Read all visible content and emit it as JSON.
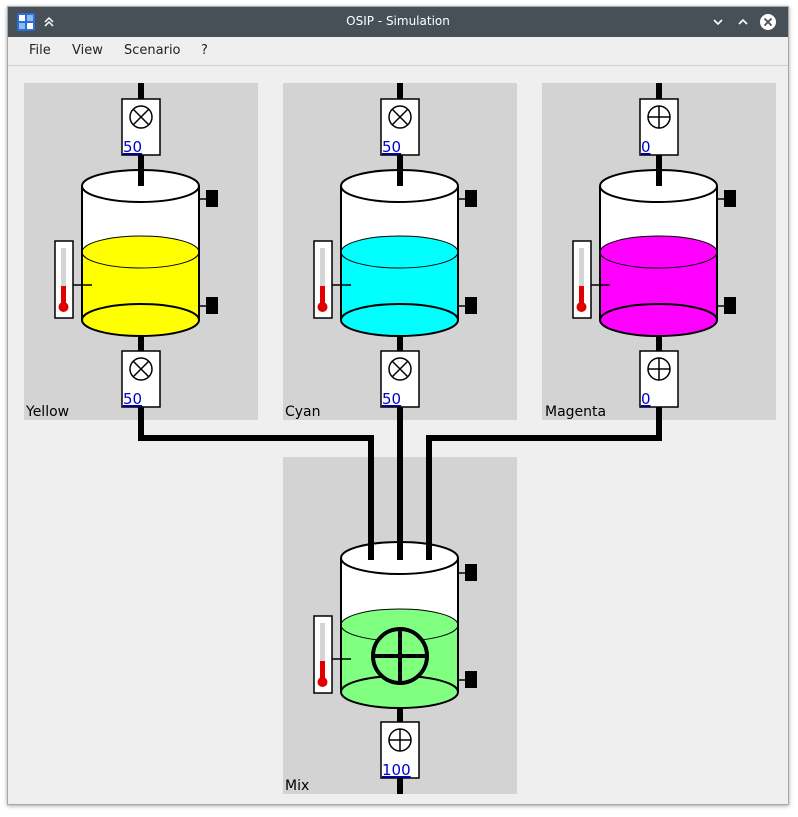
{
  "window": {
    "title": "OSIP - Simulation"
  },
  "menu": {
    "file": "File",
    "view": "View",
    "scenario": "Scenario",
    "help": "?"
  },
  "tanks": {
    "yellow": {
      "label": "Yellow",
      "inlet_value": "50",
      "outlet_value": "50",
      "color": "#ffff00",
      "inlet_state": "closed",
      "outlet_state": "closed"
    },
    "cyan": {
      "label": "Cyan",
      "inlet_value": "50",
      "outlet_value": "50",
      "color": "#00ffff",
      "inlet_state": "closed",
      "outlet_state": "closed"
    },
    "magenta": {
      "label": "Magenta",
      "inlet_value": "0",
      "outlet_value": "0",
      "color": "#ff00ff",
      "inlet_state": "open",
      "outlet_state": "open"
    },
    "mix": {
      "label": "Mix",
      "outlet_value": "100",
      "color": "#80ff80",
      "outlet_state": "open",
      "mixer": "on"
    }
  },
  "colors": {
    "titlebar": "#475057",
    "panel": "#d3d3d3",
    "thermo_red": "#e00000",
    "value_link": "#0000cc"
  }
}
